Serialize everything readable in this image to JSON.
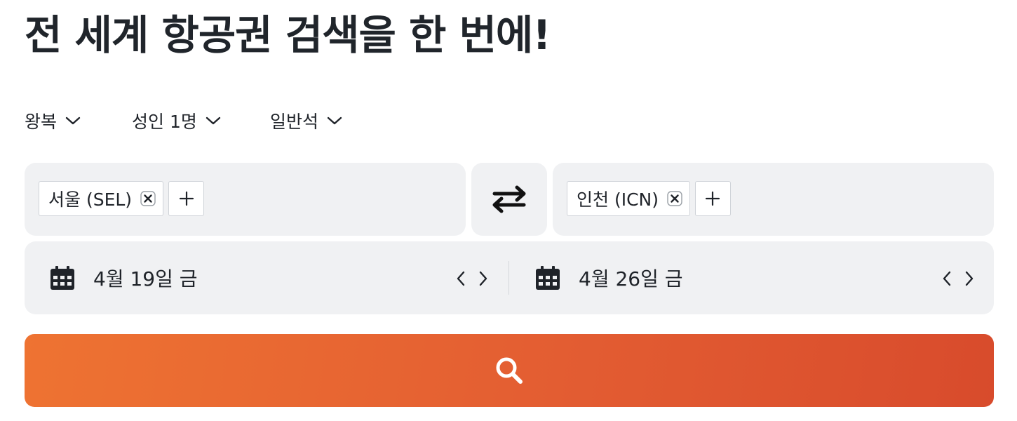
{
  "headline": "전 세계 항공권 검색을 한 번에!",
  "options": {
    "trip_type": "왕복",
    "passengers": "성인 1명",
    "cabin_class": "일반석"
  },
  "origin": {
    "chip_label": "서울 (SEL)"
  },
  "destination": {
    "chip_label": "인천 (ICN)"
  },
  "dates": {
    "depart": "4월 19일 금",
    "return": "4월 26일 금"
  },
  "icons": {
    "dropdown": "chevron-down-icon",
    "remove": "close-icon",
    "add": "plus-icon",
    "swap": "swap-arrows-icon",
    "calendar": "calendar-icon",
    "prev": "chevron-left-icon",
    "next": "chevron-right-icon",
    "search": "search-icon"
  },
  "colors": {
    "panel_bg": "#f0f1f3",
    "search_gradient_start": "#ee7332",
    "search_gradient_end": "#d84b2c",
    "text": "#1f2329"
  }
}
